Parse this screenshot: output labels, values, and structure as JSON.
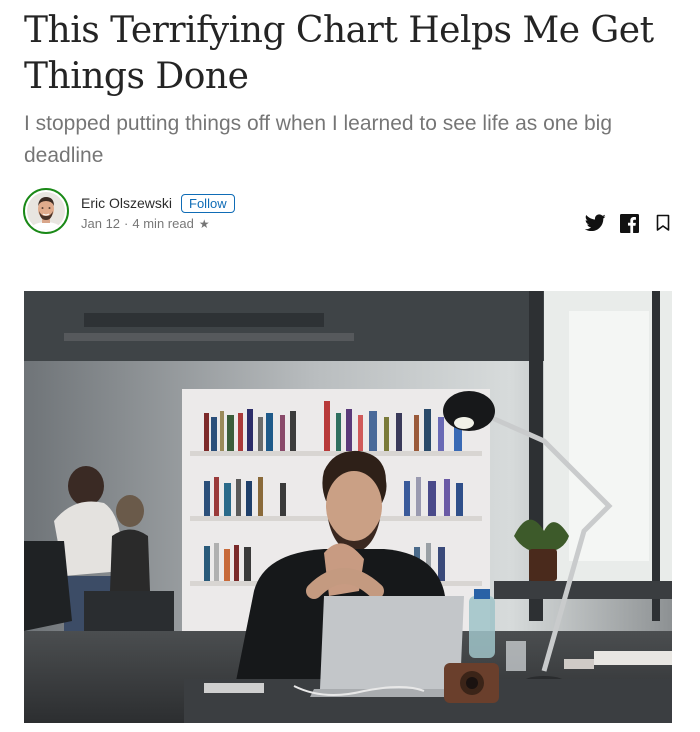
{
  "article": {
    "title": "This Terrifying Chart Helps Me Get Things Done",
    "subtitle": "I stopped putting things off when I learned to see life as one big deadline"
  },
  "author": {
    "name": "Eric Olszewski",
    "follow_label": "Follow",
    "date": "Jan 12",
    "separator": "·",
    "read_time": "4 min read",
    "member_star": "★"
  },
  "share": {
    "icons": [
      "twitter-icon",
      "facebook-icon",
      "bookmark-icon"
    ]
  },
  "hero": {
    "description_icon": "photo-man-at-laptop-in-office"
  },
  "colors": {
    "follow_accent": "#0f6cb6",
    "avatar_ring": "#1a8917"
  }
}
